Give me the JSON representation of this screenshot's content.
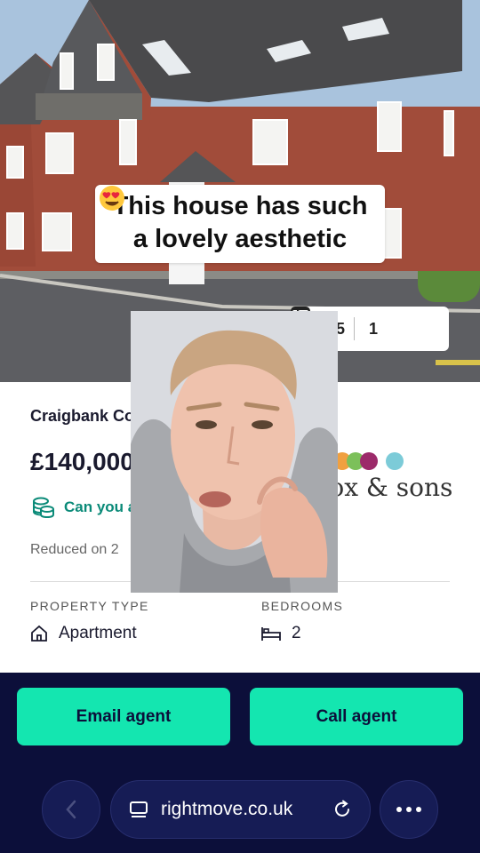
{
  "caption": {
    "line1": "This house has such",
    "line2": "a lovely aesthetic"
  },
  "photo_counter": {
    "photos": "1/15",
    "videos": "1"
  },
  "listing": {
    "title": "Craigbank Court",
    "price": "£140,000",
    "affordability": "Can you afford it?",
    "reduced": "Reduced on 2",
    "property_type_label": "PROPERTY TYPE",
    "property_type": "Apartment",
    "bedrooms_label": "BEDROOMS",
    "bedrooms": "2"
  },
  "agent": {
    "name": "fox & sons",
    "dot_colors": [
      "#e8555a",
      "#f0a040",
      "#7cc05a",
      "#9c2a6a",
      "#7ccbd8"
    ]
  },
  "actions": {
    "email": "Email agent",
    "call": "Call agent"
  },
  "browser": {
    "url": "rightmove.co.uk"
  },
  "colors": {
    "accent": "#14e6b0",
    "navy": "#0c0f3a",
    "teal_text": "#0a8a78"
  }
}
